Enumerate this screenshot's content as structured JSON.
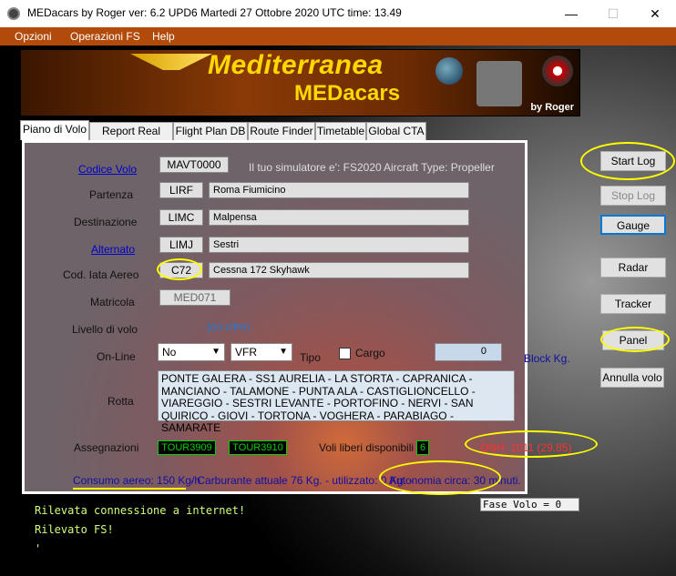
{
  "window": {
    "title": "MEDacars by Roger ver: 6.2 UPD6      Martedi 27 Ottobre 2020      UTC time: 13.49",
    "minimize": "—",
    "maximize": "☐",
    "close": "✕"
  },
  "menu": {
    "items": [
      "Opzioni",
      "Operazioni FS",
      "Help"
    ]
  },
  "banner": {
    "brand_line1": "Mediterranea",
    "brand_line2": "MEDacars",
    "by": "by Roger"
  },
  "tabs": [
    "Piano di Volo",
    "Report Real Time",
    "Flight Plan DB",
    "Route Finder",
    "Timetable",
    "Global CTA"
  ],
  "form": {
    "codice_volo": {
      "label": "Codice Volo",
      "value": "MAVT0000"
    },
    "simulator_text": "Il tuo simulatore e': FS2020",
    "aircraft_type": "Aircraft Type: Propeller",
    "partenza": {
      "label": "Partenza",
      "code": "LIRF",
      "name": "Roma Fiumicino"
    },
    "destinazione": {
      "label": "Destinazione",
      "code": "LIMC",
      "name": "Malpensa"
    },
    "alternato": {
      "label": "Alternato",
      "code": "LIMJ",
      "name": "Sestri"
    },
    "cod_iata": {
      "label": "Cod. Iata Aereo",
      "code": "C72",
      "name": "Cessna 172 Skyhawk"
    },
    "matricola": {
      "label": "Matricola",
      "value": "MED071"
    },
    "livello": {
      "label": "Livello di volo",
      "value": "(no cifre)"
    },
    "online": {
      "label": "On-Line",
      "selected": "No",
      "rules": "VFR",
      "tipo_label": "Tipo",
      "cargo_label": "Cargo",
      "cargo_value": "0",
      "block_label": "Block Kg."
    },
    "rotta": {
      "label": "Rotta",
      "value": "PONTE GALERA - SS1 AURELIA - LA STORTA - CAPRANICA - MANCIANO - TALAMONE - PUNTA ALA - CASTIGLIONCELLO - VIAREGGIO - SESTRI LEVANTE - PORTOFINO - NERVI - SAN QUIRICO - GIOVI - TORTONA - VOGHERA - PARABIAGO - SAMARATE"
    },
    "assegnazioni": {
      "label": "Assegnazioni",
      "tour1": "TOUR3909",
      "tour2": "TOUR3910"
    },
    "voli_liberi": {
      "label": "Voli liberi disponibili",
      "value": "6"
    },
    "qnh": "QNH: 1011 (29.85)",
    "consumo": "Consumo aereo: 150 Kg/h",
    "carburante": " - Carburante attuale 76 Kg. - utilizzato: 0 Kg. -",
    "autonomia": "Autonomia circa: 30 minuti."
  },
  "buttons": {
    "start_log": "Start Log",
    "stop_log": "Stop Log",
    "gauge": "Gauge",
    "radar": "Radar",
    "tracker": "Tracker",
    "panel": "Panel",
    "annulla": "Annulla volo"
  },
  "status": {
    "fase": "Fase Volo = 0"
  },
  "console": {
    "line1": "Rilevata connessione a internet!",
    "line2": "Rilevato FS!",
    "line3": "'"
  },
  "colors": {
    "menu": "#b24a0a",
    "highlight": "#ffff00",
    "tour_green": "#00d000",
    "qnh_red": "#ff3030"
  }
}
